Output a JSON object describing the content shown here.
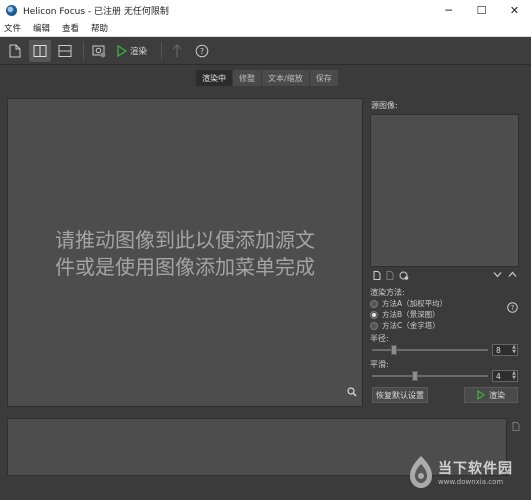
{
  "window": {
    "app_name": "Helicon Focus",
    "title_suffix": "- 已注册  无任何限制",
    "minimize": "─",
    "maximize": "☐",
    "close": "✕"
  },
  "menu": [
    "文件",
    "编辑",
    "查看",
    "帮助"
  ],
  "toolbar": {
    "render_label": "渲染"
  },
  "tabs": [
    "渲染中",
    "修整",
    "文本/缩放",
    "保存"
  ],
  "main": {
    "placeholder_line1": "请推动图像到此以便添加源文",
    "placeholder_line2": "件或是使用图像添加菜单完成"
  },
  "right": {
    "source_label": "源图像:",
    "method_label": "渲染方法:",
    "methods": [
      "方法A（加权平均）",
      "方法B（景深图）",
      "方法C（金字塔）"
    ],
    "selected_method": 1,
    "radius_label": "半径:",
    "radius_value": "8",
    "radius_level": 0.17,
    "smooth_label": "平滑:",
    "smooth_value": "4",
    "smooth_level": 0.36,
    "reset_label": "恢复默认设置",
    "render_label": "渲染"
  },
  "watermark": {
    "title": "当下软件园",
    "url": "www.downxia.com"
  },
  "colors": {
    "background": "#3b3b3b",
    "panel": "#4d4d4d",
    "active_tab": "#2c2c2c",
    "render_green": "#3db03d"
  }
}
